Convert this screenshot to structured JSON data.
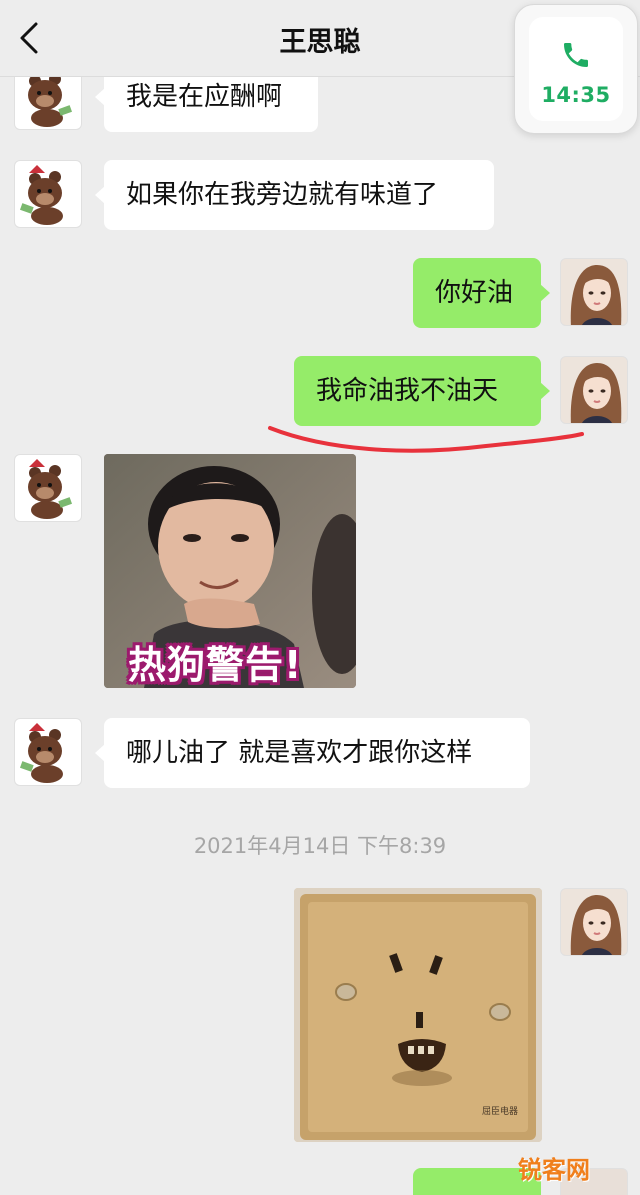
{
  "header": {
    "title": "王思聪"
  },
  "call_widget": {
    "time": "14:35"
  },
  "messages": [
    {
      "side": "in",
      "text": "我是在应酬啊"
    },
    {
      "side": "in",
      "text": "如果你在我旁边就有味道了"
    },
    {
      "side": "out",
      "text": "你好油"
    },
    {
      "side": "out",
      "text": "我命油我不油天"
    },
    {
      "side": "in",
      "type": "sticker",
      "caption": "热狗警告!"
    },
    {
      "side": "in",
      "text": "哪儿油了 就是喜欢才跟你这样"
    },
    {
      "side": "out",
      "type": "image"
    }
  ],
  "timestamp": "2021年4月14日 下午8:39",
  "photo_brand_text": "屈臣电器",
  "watermark": "锐客网",
  "colors": {
    "chat_bg": "#ededed",
    "incoming_bubble": "#ffffff",
    "outgoing_bubble": "#95ec69",
    "call_green": "#1fad63",
    "annotation_red": "#e8323c"
  }
}
